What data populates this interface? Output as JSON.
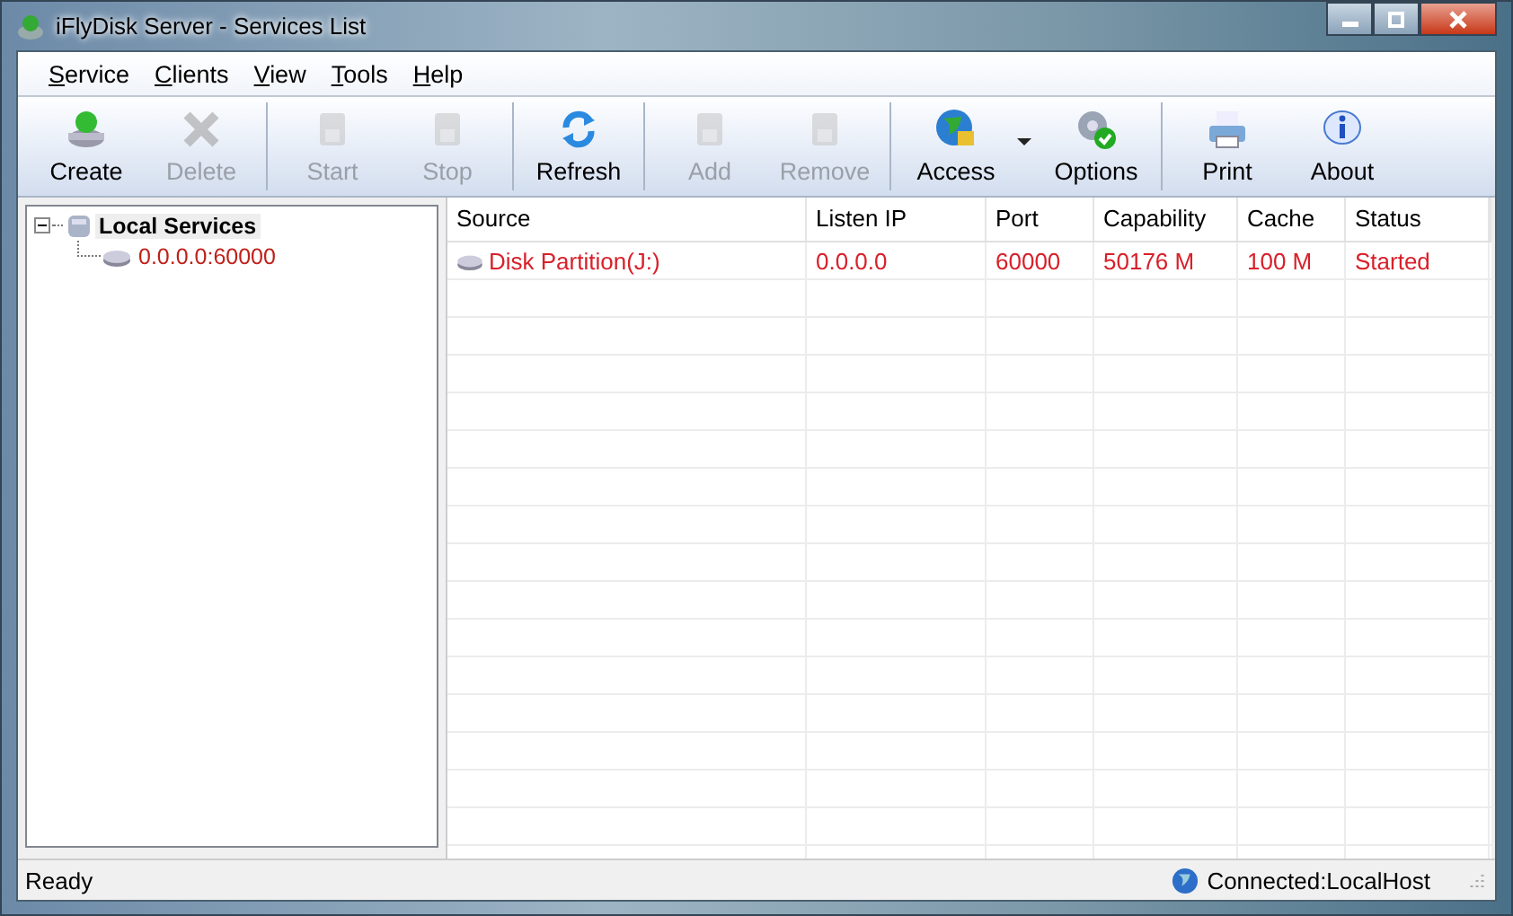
{
  "window": {
    "title": "iFlyDisk Server - Services List"
  },
  "menu": [
    {
      "label": "Service"
    },
    {
      "label": "Clients"
    },
    {
      "label": "View"
    },
    {
      "label": "Tools"
    },
    {
      "label": "Help"
    }
  ],
  "toolbar": [
    [
      {
        "label": "Create",
        "kind": "create",
        "disabled": false
      },
      {
        "label": "Delete",
        "kind": "delete",
        "disabled": true
      }
    ],
    [
      {
        "label": "Start",
        "kind": "start",
        "disabled": true
      },
      {
        "label": "Stop",
        "kind": "stop",
        "disabled": true
      }
    ],
    [
      {
        "label": "Refresh",
        "kind": "refresh",
        "disabled": false
      }
    ],
    [
      {
        "label": "Add",
        "kind": "add",
        "disabled": true
      },
      {
        "label": "Remove",
        "kind": "remove",
        "disabled": true
      }
    ],
    [
      {
        "label": "Access",
        "kind": "access",
        "disabled": false,
        "dropdown": true
      },
      {
        "label": "Options",
        "kind": "options",
        "disabled": false
      }
    ],
    [
      {
        "label": "Print",
        "kind": "print",
        "disabled": false
      },
      {
        "label": "About",
        "kind": "about",
        "disabled": false
      }
    ]
  ],
  "tree": [
    {
      "label": "Local Services",
      "expanded": true,
      "children": [
        {
          "label": "0.0.0.0:60000"
        }
      ]
    }
  ],
  "table": {
    "columns": [
      "Source",
      "Listen IP",
      "Port",
      "Capability",
      "Cache",
      "Status"
    ],
    "rows": [
      {
        "cells": [
          "Disk Partition(J:)",
          "0.0.0.0",
          "60000",
          "50176 M",
          "100 M",
          "Started"
        ],
        "active": true
      }
    ]
  },
  "status_bar": {
    "left": "Ready",
    "right": "Connected:LocalHost"
  }
}
